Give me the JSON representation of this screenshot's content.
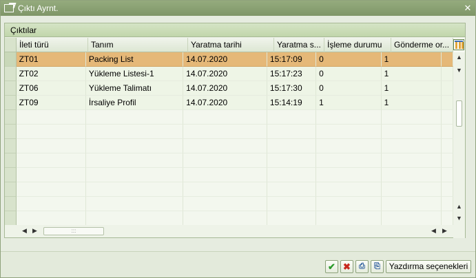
{
  "window": {
    "title": "Çıktı Ayrnt.",
    "close_label": "✕"
  },
  "panel": {
    "title": "Çıktılar"
  },
  "table": {
    "columns": [
      {
        "label": "İleti türü"
      },
      {
        "label": "Tanım"
      },
      {
        "label": "Yaratma tarihi"
      },
      {
        "label": "Yaratma s..."
      },
      {
        "label": "İşleme durumu"
      },
      {
        "label": "Gönderme or..."
      }
    ],
    "rows": [
      [
        "ZT01",
        "Packing List",
        "14.07.2020",
        "15:17:09",
        "0",
        "1"
      ],
      [
        "ZT02",
        "Yükleme Listesi-1",
        "14.07.2020",
        "15:17:23",
        "0",
        "1"
      ],
      [
        "ZT06",
        "Yükleme Talimatı",
        "14.07.2020",
        "15:17:30",
        "0",
        "1"
      ],
      [
        "ZT09",
        "İrsaliye Profil",
        "14.07.2020",
        "15:14:19",
        "1",
        "1"
      ]
    ],
    "selected_row": 0
  },
  "buttons": {
    "print_options": "Yazdırma seçenekleri"
  },
  "colors": {
    "selected": "#e5b878",
    "titlebar": "#8aa173"
  }
}
